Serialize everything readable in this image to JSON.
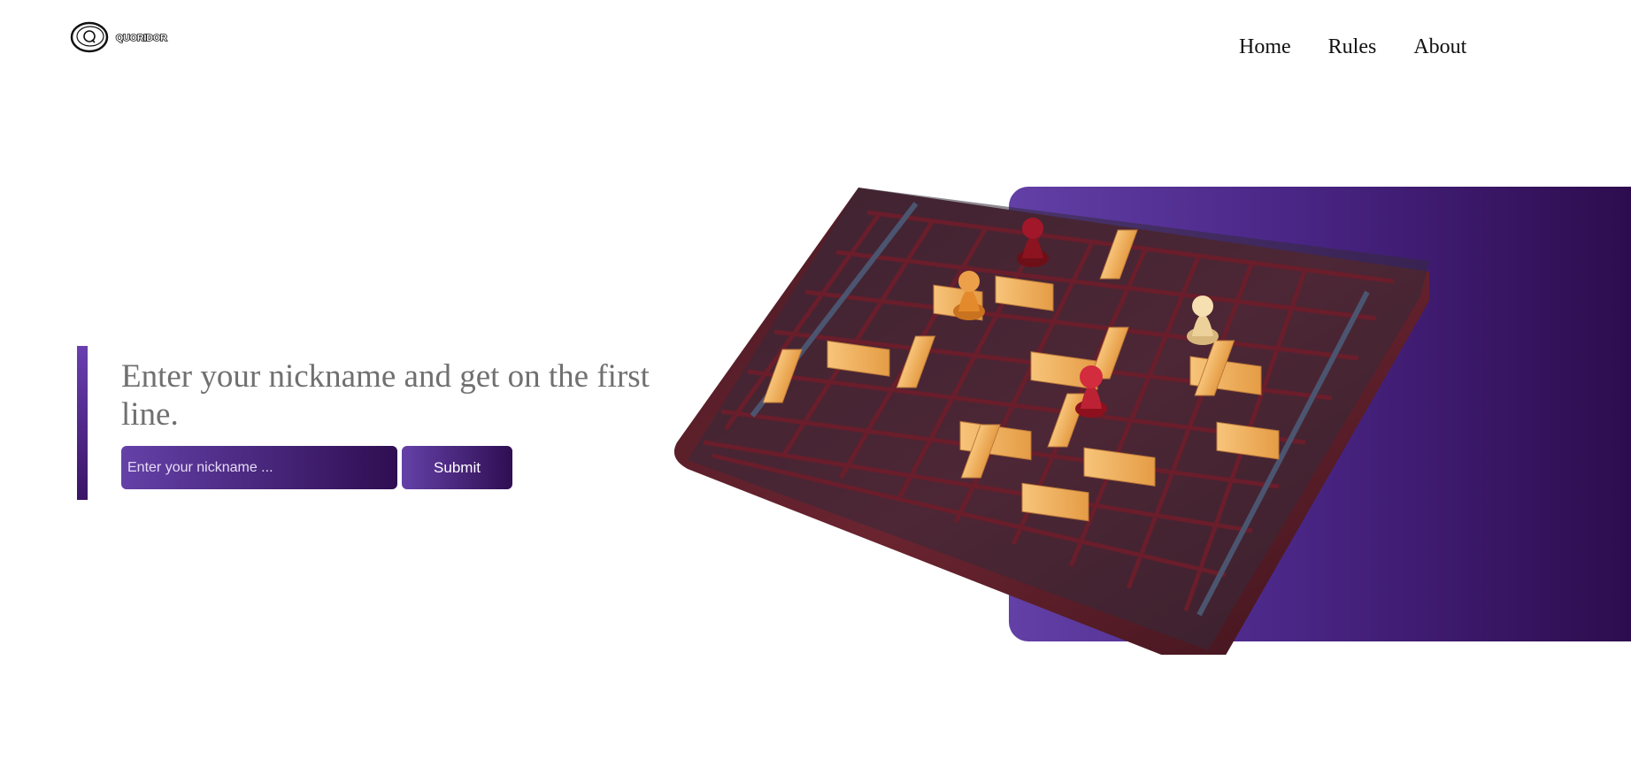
{
  "header": {
    "logo_text": "QUORIDOR",
    "logo_letter": "Q",
    "nav": [
      {
        "label": "Home"
      },
      {
        "label": "Rules"
      },
      {
        "label": "About"
      }
    ]
  },
  "hero": {
    "headline": "Enter your nickname and get on the first line.",
    "nickname_input": {
      "value": "",
      "placeholder": "Enter your nickname ..."
    },
    "submit_label": "Submit"
  },
  "theme": {
    "accent_light": "#6441a8",
    "accent_dark": "#2f0e52",
    "headline_color": "#707070",
    "board_wood": "#5b1f2a",
    "board_tile": "#2c2b3d",
    "wall_color": "#f2b563",
    "pawn_red": "#c8283a",
    "pawn_orange": "#e79a3c",
    "pawn_cream": "#f3d8a4"
  },
  "images": {
    "board": "quoridor-board-image"
  }
}
